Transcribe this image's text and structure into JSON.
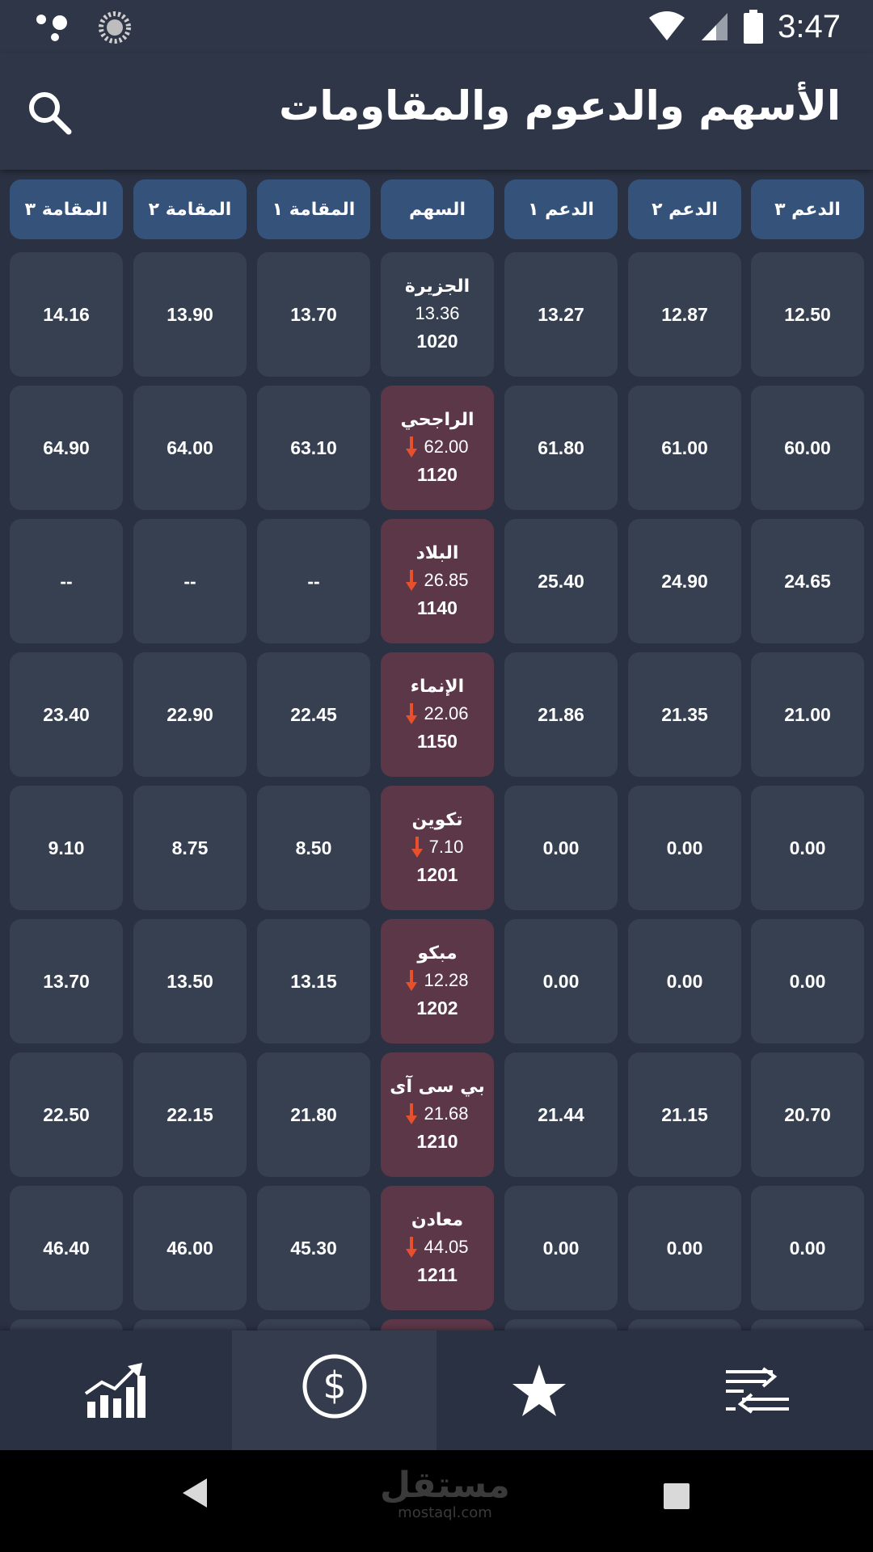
{
  "status_bar": {
    "time": "3:47"
  },
  "app_bar": {
    "title": "الأسهم والدعوم والمقاومات"
  },
  "columns": [
    "المقامة ٣",
    "المقامة ٢",
    "المقامة ١",
    "السهم",
    "الدعم ١",
    "الدعم ٢",
    "الدعم ٣"
  ],
  "rows": [
    {
      "name": "الجزيرة",
      "price": "13.36",
      "code": "1020",
      "trend": "flat",
      "r3": "14.16",
      "r2": "13.90",
      "r1": "13.70",
      "s1": "13.27",
      "s2": "12.87",
      "s3": "12.50"
    },
    {
      "name": "الراجحي",
      "price": "62.00",
      "code": "1120",
      "trend": "down",
      "r3": "64.90",
      "r2": "64.00",
      "r1": "63.10",
      "s1": "61.80",
      "s2": "61.00",
      "s3": "60.00"
    },
    {
      "name": "البلاد",
      "price": "26.85",
      "code": "1140",
      "trend": "down",
      "r3": "--",
      "r2": "--",
      "r1": "--",
      "s1": "25.40",
      "s2": "24.90",
      "s3": "24.65"
    },
    {
      "name": "الإنماء",
      "price": "22.06",
      "code": "1150",
      "trend": "down",
      "r3": "23.40",
      "r2": "22.90",
      "r1": "22.45",
      "s1": "21.86",
      "s2": "21.35",
      "s3": "21.00"
    },
    {
      "name": "تكوين",
      "price": "7.10",
      "code": "1201",
      "trend": "down",
      "r3": "9.10",
      "r2": "8.75",
      "r1": "8.50",
      "s1": "0.00",
      "s2": "0.00",
      "s3": "0.00"
    },
    {
      "name": "مبكو",
      "price": "12.28",
      "code": "1202",
      "trend": "down",
      "r3": "13.70",
      "r2": "13.50",
      "r1": "13.15",
      "s1": "0.00",
      "s2": "0.00",
      "s3": "0.00"
    },
    {
      "name": "بي سى آى",
      "price": "21.68",
      "code": "1210",
      "trend": "down",
      "r3": "22.50",
      "r2": "22.15",
      "r1": "21.80",
      "s1": "21.44",
      "s2": "21.15",
      "s3": "20.70"
    },
    {
      "name": "معادن",
      "price": "44.05",
      "code": "1211",
      "trend": "down",
      "r3": "46.40",
      "r2": "46.00",
      "r1": "45.30",
      "s1": "0.00",
      "s2": "0.00",
      "s3": "0.00"
    }
  ],
  "bottom_nav": {
    "items": [
      {
        "icon": "chart-growth-icon",
        "active": false
      },
      {
        "icon": "dollar-icon",
        "active": true
      },
      {
        "icon": "star-icon",
        "active": false
      },
      {
        "icon": "transfer-list-icon",
        "active": false
      }
    ]
  },
  "watermark": {
    "arabic": "مستقل",
    "latin": "mostaql.com"
  },
  "colors": {
    "header_cell": "#34527a",
    "cell": "#374051",
    "stock_down": "#5b3747",
    "down_arrow": "#e8502c",
    "background": "#2a3142"
  }
}
